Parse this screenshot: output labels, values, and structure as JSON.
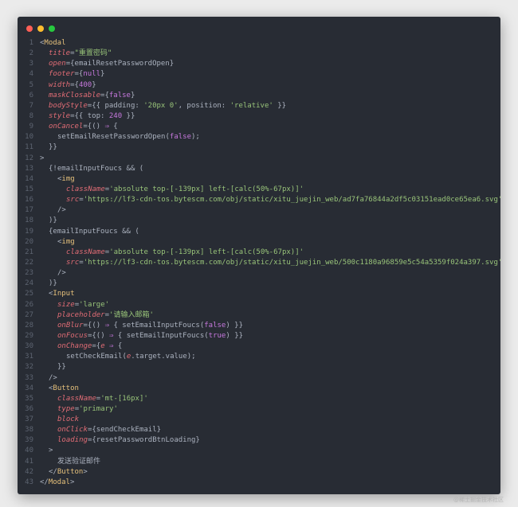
{
  "window": {
    "controls": [
      "close",
      "minimize",
      "maximize"
    ],
    "colors": {
      "close": "#ff5f56",
      "minimize": "#ffbd2e",
      "maximize": "#27c93f",
      "background": "#282c34"
    }
  },
  "code_lines": [
    {
      "n": "1",
      "indent": 0,
      "tokens": [
        [
          "p",
          "<"
        ],
        [
          "tag",
          "Modal"
        ]
      ]
    },
    {
      "n": "2",
      "indent": 1,
      "tokens": [
        [
          "attr",
          "title"
        ],
        [
          "p",
          "="
        ],
        [
          "str",
          "\"重置密码\""
        ]
      ]
    },
    {
      "n": "3",
      "indent": 1,
      "tokens": [
        [
          "attr",
          "open"
        ],
        [
          "p",
          "={"
        ],
        [
          "fn",
          "emailResetPasswordOpen"
        ],
        [
          "p",
          "}"
        ]
      ]
    },
    {
      "n": "4",
      "indent": 1,
      "tokens": [
        [
          "attr",
          "footer"
        ],
        [
          "p",
          "={"
        ],
        [
          "kw",
          "null"
        ],
        [
          "p",
          "}"
        ]
      ]
    },
    {
      "n": "5",
      "indent": 1,
      "tokens": [
        [
          "attr",
          "width"
        ],
        [
          "p",
          "={"
        ],
        [
          "kw",
          "400"
        ],
        [
          "p",
          "}"
        ]
      ]
    },
    {
      "n": "6",
      "indent": 1,
      "tokens": [
        [
          "attr",
          "maskClosable"
        ],
        [
          "p",
          "={"
        ],
        [
          "kw",
          "false"
        ],
        [
          "p",
          "}"
        ]
      ]
    },
    {
      "n": "7",
      "indent": 1,
      "tokens": [
        [
          "attr",
          "bodyStyle"
        ],
        [
          "p",
          "={{ padding: "
        ],
        [
          "str",
          "'20px 0'"
        ],
        [
          "p",
          ", position: "
        ],
        [
          "str",
          "'relative'"
        ],
        [
          "p",
          " }}"
        ]
      ]
    },
    {
      "n": "8",
      "indent": 1,
      "tokens": [
        [
          "attr",
          "style"
        ],
        [
          "p",
          "={{ top: "
        ],
        [
          "kw",
          "240"
        ],
        [
          "p",
          " }}"
        ]
      ]
    },
    {
      "n": "9",
      "indent": 1,
      "tokens": [
        [
          "attr",
          "onCancel"
        ],
        [
          "p",
          "={() "
        ],
        [
          "kw",
          "⇒"
        ],
        [
          "p",
          " {"
        ]
      ]
    },
    {
      "n": "10",
      "indent": 2,
      "tokens": [
        [
          "fn",
          "setEmailResetPasswordOpen"
        ],
        [
          "p",
          "("
        ],
        [
          "kw",
          "false"
        ],
        [
          "p",
          ");"
        ]
      ]
    },
    {
      "n": "11",
      "indent": 1,
      "tokens": [
        [
          "p",
          "}}"
        ]
      ]
    },
    {
      "n": "12",
      "indent": 0,
      "tokens": [
        [
          "p",
          ">"
        ]
      ]
    },
    {
      "n": "13",
      "indent": 1,
      "tokens": [
        [
          "p",
          "{!"
        ],
        [
          "fn",
          "emailInputFoucs"
        ],
        [
          "p",
          " && ("
        ]
      ]
    },
    {
      "n": "14",
      "indent": 2,
      "tokens": [
        [
          "p",
          "<"
        ],
        [
          "tag",
          "img"
        ]
      ]
    },
    {
      "n": "15",
      "indent": 3,
      "tokens": [
        [
          "attr",
          "className"
        ],
        [
          "p",
          "="
        ],
        [
          "str",
          "'absolute top-[-139px] left-[calc(50%-67px)]'"
        ]
      ]
    },
    {
      "n": "16",
      "indent": 3,
      "tokens": [
        [
          "attr",
          "src"
        ],
        [
          "p",
          "="
        ],
        [
          "str",
          "'https://lf3-cdn-tos.bytescm.com/obj/static/xitu_juejin_web/ad7fa76844a2df5c03151ead0ce65ea6.svg'"
        ]
      ]
    },
    {
      "n": "17",
      "indent": 2,
      "tokens": [
        [
          "p",
          "/>"
        ]
      ]
    },
    {
      "n": "18",
      "indent": 1,
      "tokens": [
        [
          "p",
          ")}"
        ]
      ]
    },
    {
      "n": "19",
      "indent": 1,
      "tokens": [
        [
          "p",
          "{"
        ],
        [
          "fn",
          "emailInputFoucs"
        ],
        [
          "p",
          " && ("
        ]
      ]
    },
    {
      "n": "20",
      "indent": 2,
      "tokens": [
        [
          "p",
          "<"
        ],
        [
          "tag",
          "img"
        ]
      ]
    },
    {
      "n": "21",
      "indent": 3,
      "tokens": [
        [
          "attr",
          "className"
        ],
        [
          "p",
          "="
        ],
        [
          "str",
          "'absolute top-[-139px] left-[calc(50%-67px)]'"
        ]
      ]
    },
    {
      "n": "22",
      "indent": 3,
      "tokens": [
        [
          "attr",
          "src"
        ],
        [
          "p",
          "="
        ],
        [
          "str",
          "'https://lf3-cdn-tos.bytescm.com/obj/static/xitu_juejin_web/500c1180a96859e5c54a5359f024a397.svg'"
        ]
      ]
    },
    {
      "n": "23",
      "indent": 2,
      "tokens": [
        [
          "p",
          "/>"
        ]
      ]
    },
    {
      "n": "24",
      "indent": 1,
      "tokens": [
        [
          "p",
          ")}"
        ]
      ]
    },
    {
      "n": "25",
      "indent": 1,
      "tokens": [
        [
          "p",
          "<"
        ],
        [
          "tag",
          "Input"
        ]
      ]
    },
    {
      "n": "26",
      "indent": 2,
      "tokens": [
        [
          "attr",
          "size"
        ],
        [
          "p",
          "="
        ],
        [
          "str",
          "'large'"
        ]
      ]
    },
    {
      "n": "27",
      "indent": 2,
      "tokens": [
        [
          "attr",
          "placeholder"
        ],
        [
          "p",
          "="
        ],
        [
          "str",
          "'请输入邮箱'"
        ]
      ]
    },
    {
      "n": "28",
      "indent": 2,
      "tokens": [
        [
          "attr",
          "onBlur"
        ],
        [
          "p",
          "={() "
        ],
        [
          "kw",
          "⇒"
        ],
        [
          "p",
          " { setEmailInputFoucs("
        ],
        [
          "kw",
          "false"
        ],
        [
          "p",
          ") }}"
        ]
      ]
    },
    {
      "n": "29",
      "indent": 2,
      "tokens": [
        [
          "attr",
          "onFocus"
        ],
        [
          "p",
          "={() "
        ],
        [
          "kw",
          "⇒"
        ],
        [
          "p",
          " { setEmailInputFoucs("
        ],
        [
          "kw",
          "true"
        ],
        [
          "p",
          ") }}"
        ]
      ]
    },
    {
      "n": "30",
      "indent": 2,
      "tokens": [
        [
          "attr",
          "onChange"
        ],
        [
          "p",
          "={"
        ],
        [
          "attr",
          "e"
        ],
        [
          "p",
          " "
        ],
        [
          "kw",
          "⇒"
        ],
        [
          "p",
          " {"
        ]
      ]
    },
    {
      "n": "31",
      "indent": 3,
      "tokens": [
        [
          "fn",
          "setCheckEmail"
        ],
        [
          "p",
          "("
        ],
        [
          "attr",
          "e"
        ],
        [
          "p",
          ".target.value);"
        ]
      ]
    },
    {
      "n": "32",
      "indent": 2,
      "tokens": [
        [
          "p",
          "}}"
        ]
      ]
    },
    {
      "n": "33",
      "indent": 1,
      "tokens": [
        [
          "p",
          "/>"
        ]
      ]
    },
    {
      "n": "34",
      "indent": 1,
      "tokens": [
        [
          "p",
          "<"
        ],
        [
          "tag",
          "Button"
        ]
      ]
    },
    {
      "n": "35",
      "indent": 2,
      "tokens": [
        [
          "attr",
          "className"
        ],
        [
          "p",
          "="
        ],
        [
          "str",
          "'mt-[16px]'"
        ]
      ]
    },
    {
      "n": "36",
      "indent": 2,
      "tokens": [
        [
          "attr",
          "type"
        ],
        [
          "p",
          "="
        ],
        [
          "str",
          "'primary'"
        ]
      ]
    },
    {
      "n": "37",
      "indent": 2,
      "tokens": [
        [
          "attr",
          "block"
        ]
      ]
    },
    {
      "n": "38",
      "indent": 2,
      "tokens": [
        [
          "attr",
          "onClick"
        ],
        [
          "p",
          "={"
        ],
        [
          "fn",
          "sendCheckEmail"
        ],
        [
          "p",
          "}"
        ]
      ]
    },
    {
      "n": "39",
      "indent": 2,
      "tokens": [
        [
          "attr",
          "loading"
        ],
        [
          "p",
          "={"
        ],
        [
          "fn",
          "resetPasswordBtnLoading"
        ],
        [
          "p",
          "}"
        ]
      ]
    },
    {
      "n": "40",
      "indent": 1,
      "tokens": [
        [
          "p",
          ">"
        ]
      ]
    },
    {
      "n": "41",
      "indent": 2,
      "tokens": [
        [
          "p",
          "发送验证邮件"
        ]
      ]
    },
    {
      "n": "42",
      "indent": 1,
      "tokens": [
        [
          "p",
          "</"
        ],
        [
          "tag",
          "Button"
        ],
        [
          "p",
          ">"
        ]
      ]
    },
    {
      "n": "43",
      "indent": 0,
      "tokens": [
        [
          "p",
          "</"
        ],
        [
          "tag",
          "Modal"
        ],
        [
          "p",
          ">"
        ]
      ]
    }
  ],
  "watermark": "@稀土掘金技术社区"
}
